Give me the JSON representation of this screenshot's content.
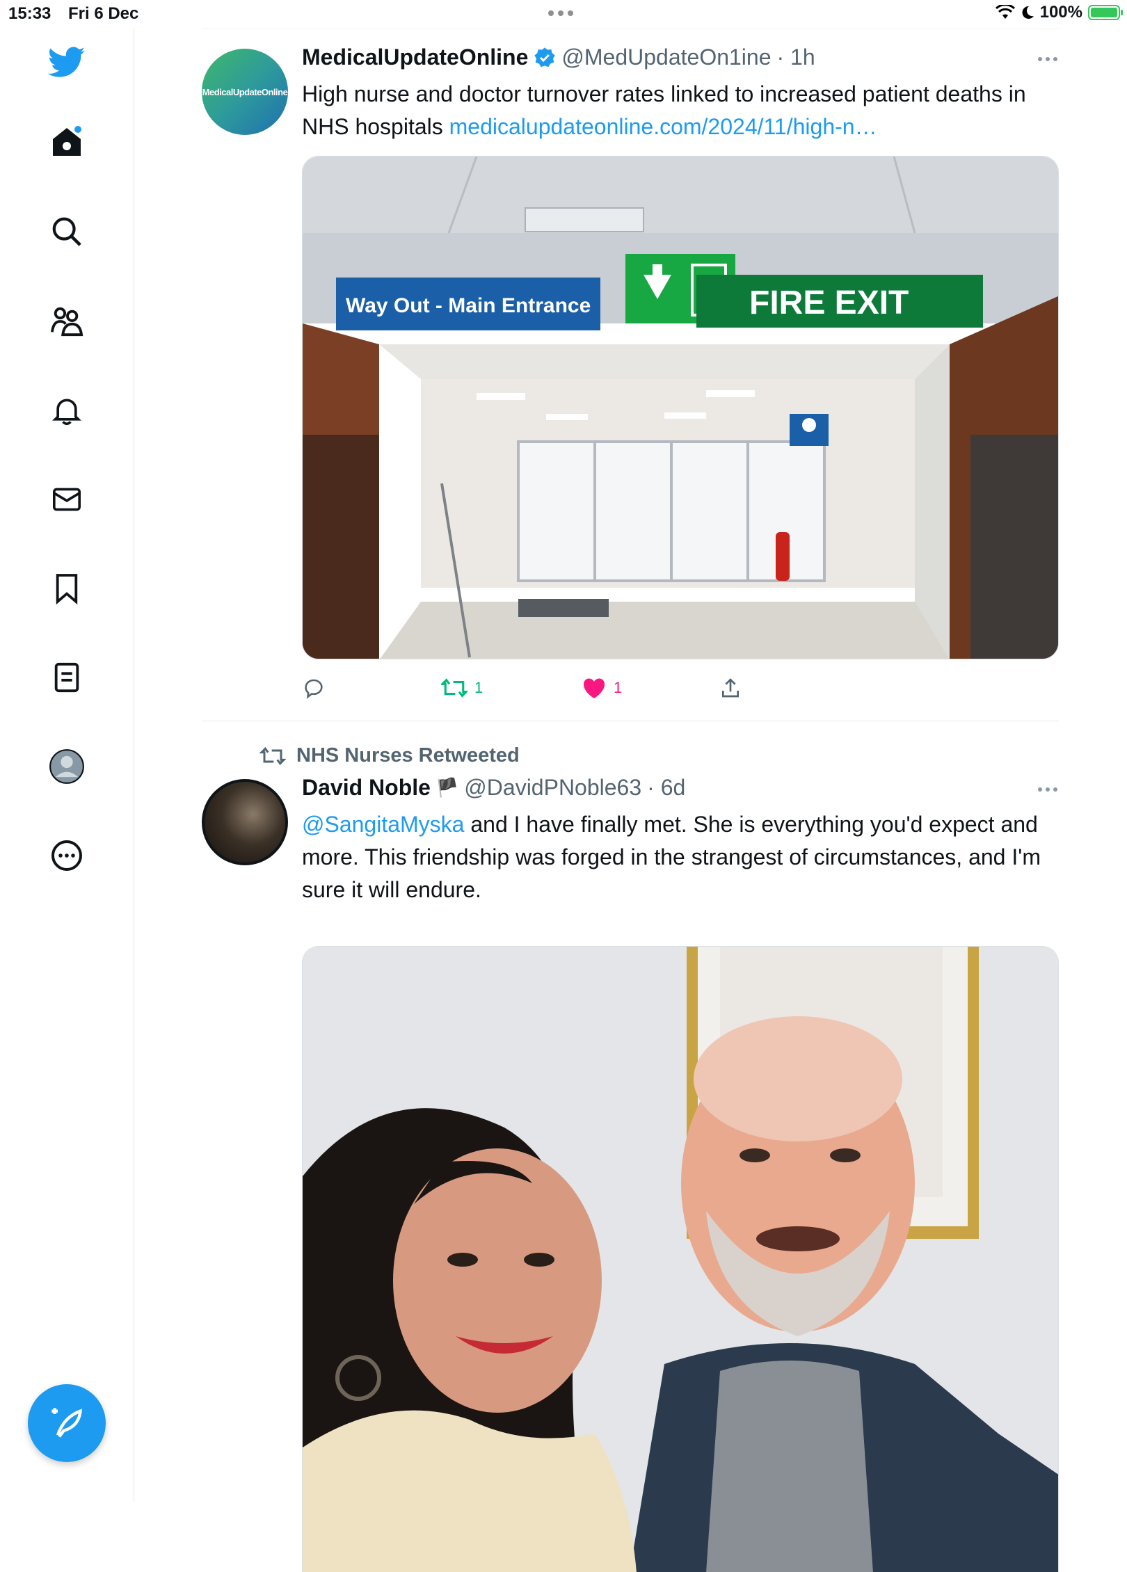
{
  "status_bar": {
    "time": "15:33",
    "date": "Fri 6 Dec",
    "battery": "100%"
  },
  "sidebar": {
    "items": [
      {
        "name": "home",
        "icon": "home-icon"
      },
      {
        "name": "search",
        "icon": "search-icon"
      },
      {
        "name": "communities",
        "icon": "communities-icon"
      },
      {
        "name": "notifications",
        "icon": "bell-icon"
      },
      {
        "name": "messages",
        "icon": "envelope-icon"
      },
      {
        "name": "bookmarks",
        "icon": "bookmark-icon"
      },
      {
        "name": "lists",
        "icon": "list-icon"
      },
      {
        "name": "profile",
        "icon": "profile-icon"
      },
      {
        "name": "more",
        "icon": "more-circle-icon"
      }
    ],
    "compose_icon": "compose-icon",
    "accent": "#1d9bf0"
  },
  "tweets": [
    {
      "avatar_text": "MedicalUpdateOnline",
      "name": "MedicalUpdateOnline",
      "handle": "@MedUpdateOn1ine",
      "time": "· 1h",
      "verified": true,
      "text": "High nurse and doctor turnover rates linked to increased patient deaths in NHS hospitals ",
      "link": "medicalupdateonline.com/2024/11/high-n…",
      "media": {
        "sign_left": "Way Out - Main Entrance",
        "sign_right": "FIRE EXIT"
      },
      "actions": {
        "replies": "",
        "retweets": "1",
        "likes": "1",
        "retweet_color": "#00ba7c",
        "like_color": "#f91880"
      }
    },
    {
      "retweeted_by": "NHS Nurses Retweeted",
      "name": "David Noble",
      "flag": "🏴",
      "handle": "@DavidPNoble63",
      "time": "· 6d",
      "mention": "@SangitaMyska",
      "text": " and I have finally met. She is everything you'd expect and more. This friendship was forged in the strangest of circumstances, and I'm sure it will endure."
    }
  ]
}
